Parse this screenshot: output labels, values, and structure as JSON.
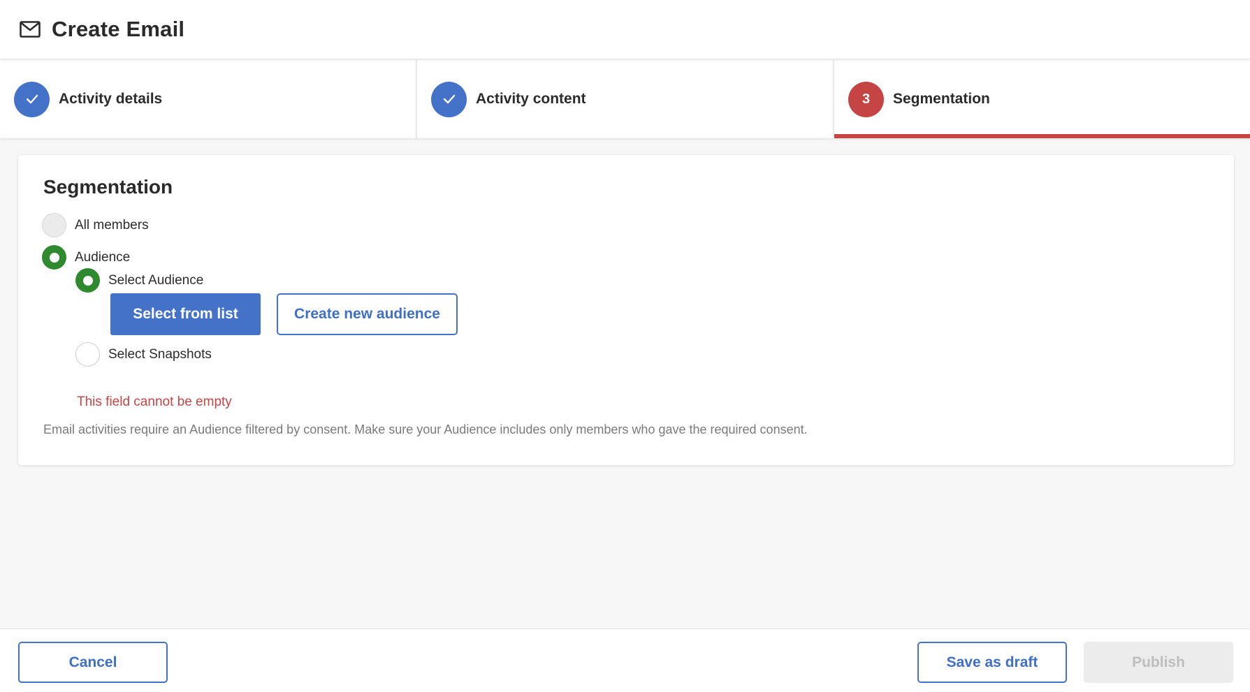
{
  "header": {
    "title": "Create Email",
    "icon": "mail-icon"
  },
  "stepper": {
    "steps": [
      {
        "label": "Activity details",
        "state": "done",
        "marker": ""
      },
      {
        "label": "Activity content",
        "state": "done",
        "marker": ""
      },
      {
        "label": "Segmentation",
        "state": "active",
        "marker": "3"
      }
    ]
  },
  "segmentation": {
    "title": "Segmentation",
    "options": {
      "all_members": "All members",
      "audience": "Audience",
      "select_audience": "Select Audience",
      "select_snapshots": "Select Snapshots"
    },
    "selected": "audience",
    "sub_selected": "select_audience",
    "buttons": {
      "select_from_list": "Select from list",
      "create_new_audience": "Create new audience"
    },
    "error": "This field cannot be empty",
    "help": "Email activities require an Audience filtered by consent. Make sure your Audience includes only members who gave the required consent."
  },
  "footer": {
    "cancel": "Cancel",
    "save_draft": "Save as draft",
    "publish": "Publish"
  },
  "colors": {
    "primary": "#4472c9",
    "error": "#c54444",
    "success": "#2f8a2f",
    "disabled": "#ececec"
  }
}
